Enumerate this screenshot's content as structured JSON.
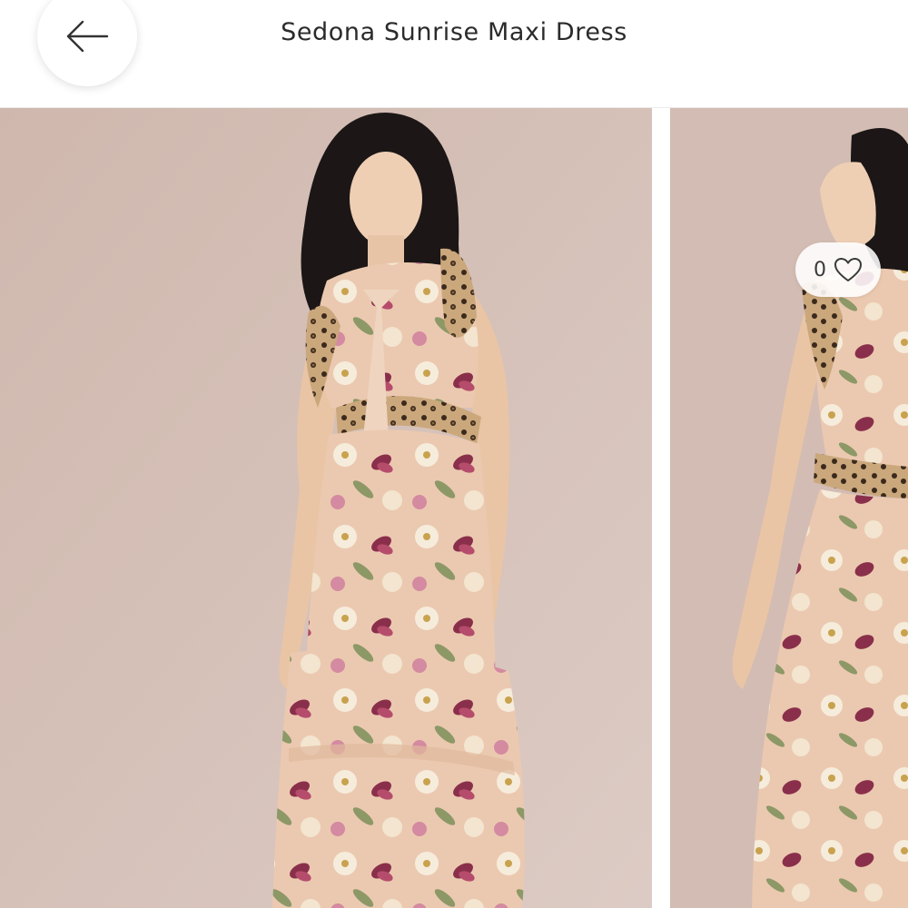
{
  "header": {
    "title": "Sedona Sunrise Maxi Dress",
    "back_icon": "arrow-left-icon"
  },
  "gallery": {
    "favorite": {
      "count": "0",
      "icon": "heart-outline-icon"
    },
    "images": [
      {
        "subject": "model-front-view"
      },
      {
        "subject": "model-side-view"
      }
    ]
  },
  "colors": {
    "backdrop": "#d6c1b9",
    "dress_base": "#ebc9b0",
    "flower_magenta": "#8a2f4b",
    "flower_cream": "#f6ecdc",
    "leopard": "#8a6a45"
  }
}
